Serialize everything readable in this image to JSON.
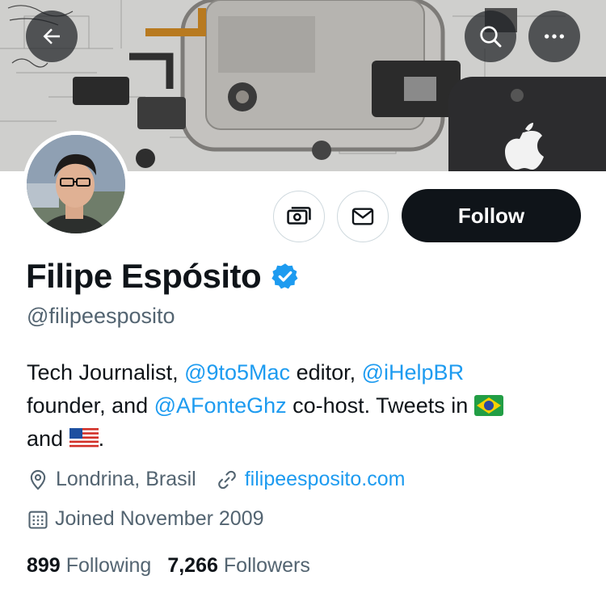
{
  "header": {
    "back_icon": "arrow-left-icon",
    "search_icon": "search-icon",
    "more_icon": "more-horizontal-icon"
  },
  "profile": {
    "display_name": "Filipe Espósito",
    "handle": "@filipeesposito",
    "verified": true,
    "follow_label": "Follow",
    "tips_icon": "money-icon",
    "message_icon": "envelope-icon"
  },
  "bio": {
    "part1": "Tech Journalist, ",
    "mention1": "@9to5Mac",
    "part2": " editor, ",
    "mention2": "@iHelpBR",
    "part3": " founder, and ",
    "mention3": "@AFonteGhz",
    "part4": " co-host. Tweets in ",
    "part5": " and ",
    "part6": "."
  },
  "meta": {
    "location": "Londrina, Brasil",
    "website": "filipeesposito.com",
    "joined": "Joined November 2009"
  },
  "stats": {
    "following_count": "899",
    "following_label": "Following",
    "followers_count": "7,266",
    "followers_label": "Followers"
  },
  "colors": {
    "accent": "#1d9bf0",
    "text_primary": "#0f1419",
    "text_secondary": "#536471",
    "follow_bg": "#0f1419"
  }
}
